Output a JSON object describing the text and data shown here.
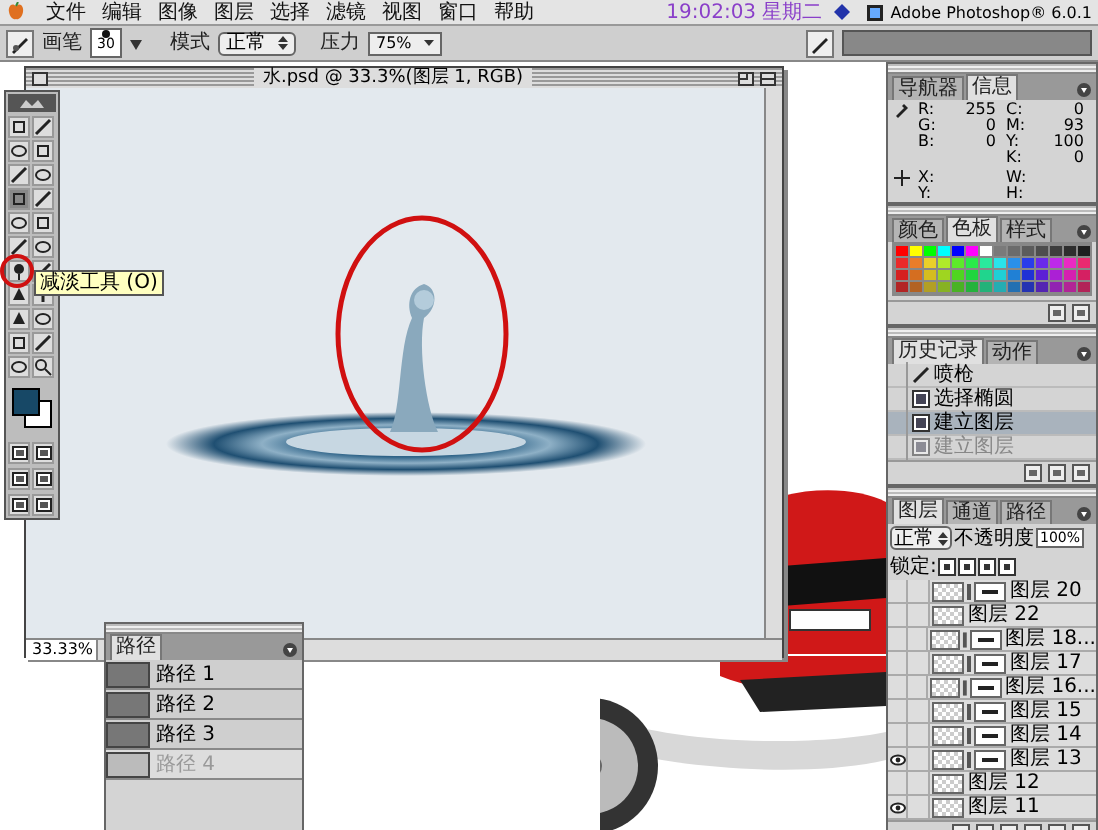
{
  "menu_bar": {
    "items": [
      "文件",
      "编辑",
      "图像",
      "图层",
      "选择",
      "滤镜",
      "视图",
      "窗口",
      "帮助"
    ],
    "clock": "19:02:03 星期二",
    "app_name": "Adobe Photoshop® 6.0.1"
  },
  "options_bar": {
    "brush_label": "画笔",
    "brush_size": "30",
    "mode_label": "模式",
    "mode": "正常",
    "pressure_label": "压力",
    "pressure": "75%"
  },
  "toolbox": {
    "tooltip": "减淡工具 (O)"
  },
  "document": {
    "title": "水.psd @ 33.3%(图层 1, RGB)",
    "zoom": "33.33%"
  },
  "info_panel": {
    "tabs": [
      {
        "label": "导航器",
        "selected": false
      },
      {
        "label": "信息",
        "selected": true
      }
    ],
    "color_readings": [
      {
        "label": "R:",
        "value": "255"
      },
      {
        "label": "G:",
        "value": "0"
      },
      {
        "label": "B:",
        "value": "0"
      }
    ],
    "cmyk_readings": [
      {
        "label": "C:",
        "value": "0"
      },
      {
        "label": "M:",
        "value": "93"
      },
      {
        "label": "Y:",
        "value": "100"
      },
      {
        "label": "K:",
        "value": "0"
      }
    ],
    "position_labels": [
      "X:",
      "Y:"
    ],
    "size_labels": [
      "W:",
      "H:"
    ]
  },
  "swatches_panel": {
    "tabs": [
      {
        "label": "颜色",
        "selected": false
      },
      {
        "label": "色板",
        "selected": true
      },
      {
        "label": "样式",
        "selected": false
      }
    ]
  },
  "history_panel": {
    "tabs": [
      {
        "label": "历史记录",
        "selected": true
      },
      {
        "label": "动作",
        "selected": false
      }
    ],
    "items": [
      {
        "label": "喷枪",
        "selected": false,
        "undone": false
      },
      {
        "label": "选择椭圆",
        "selected": false,
        "undone": false
      },
      {
        "label": "建立图层",
        "selected": true,
        "undone": false
      },
      {
        "label": "建立图层",
        "selected": false,
        "undone": true
      }
    ]
  },
  "layers_panel": {
    "tabs": [
      {
        "label": "图层",
        "selected": true
      },
      {
        "label": "通道",
        "selected": false
      },
      {
        "label": "路径",
        "selected": false
      }
    ],
    "blend_mode": "正常",
    "opacity_label": "不透明度",
    "opacity": "100%",
    "lock_label": "锁定:",
    "layers": [
      {
        "name": "图层 20",
        "kind": "masked",
        "visible": false
      },
      {
        "name": "图层 22",
        "kind": "plain",
        "visible": false
      },
      {
        "name": "图层 18...",
        "kind": "masked",
        "visible": false
      },
      {
        "name": "图层 17",
        "kind": "masked",
        "visible": false
      },
      {
        "name": "图层 16...",
        "kind": "masked",
        "visible": false
      },
      {
        "name": "图层 15",
        "kind": "masked",
        "visible": false
      },
      {
        "name": "图层 14",
        "kind": "masked",
        "visible": false
      },
      {
        "name": "图层 13",
        "kind": "masked",
        "visible": true
      },
      {
        "name": "图层 12",
        "kind": "plain",
        "visible": false
      },
      {
        "name": "图层 11",
        "kind": "plain",
        "visible": true
      }
    ]
  },
  "paths_panel": {
    "tabs": [
      {
        "label": "路径",
        "selected": true
      }
    ],
    "items": [
      {
        "label": "路径 1",
        "disabled": false
      },
      {
        "label": "路径 2",
        "disabled": false
      },
      {
        "label": "路径 3",
        "disabled": false
      },
      {
        "label": "路径 4",
        "disabled": true
      }
    ]
  }
}
